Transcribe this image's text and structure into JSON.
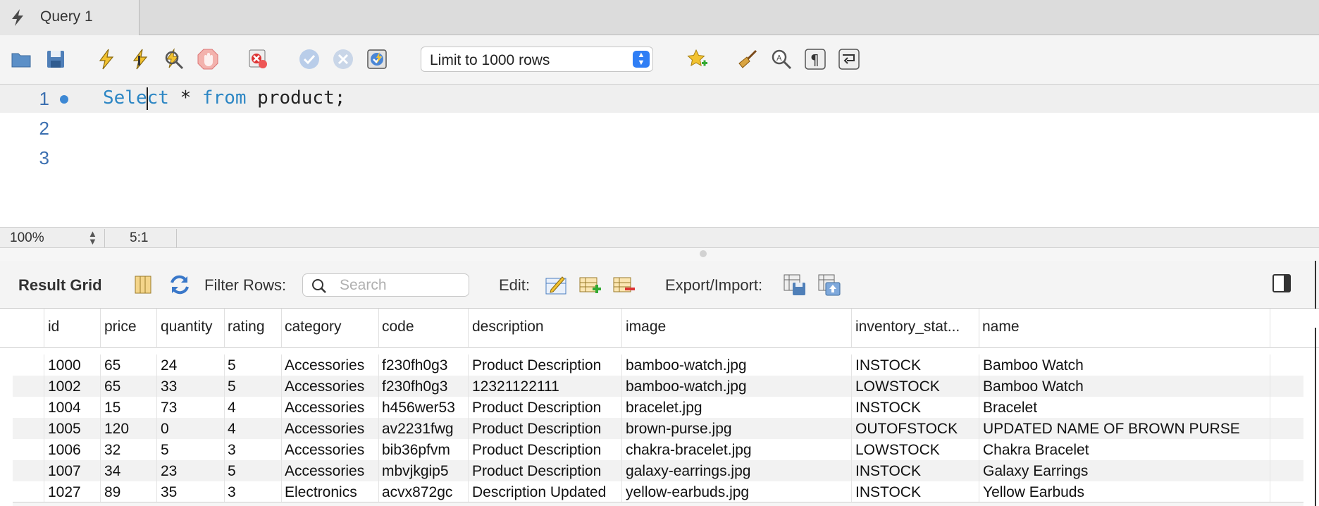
{
  "tab": {
    "title": "Query 1"
  },
  "toolbar": {
    "icons": [
      "open-folder-icon",
      "save-icon",
      "execute-icon",
      "execute-current-icon",
      "explain-icon",
      "stop-icon",
      "error-stop-icon",
      "commit-icon",
      "rollback-icon",
      "autocommit-icon",
      "bookmark-icon",
      "beautify-icon",
      "find-icon",
      "invisible-chars-icon",
      "wrap-icon"
    ],
    "limit_select": "Limit to 1000 rows"
  },
  "editor": {
    "lines": [
      {
        "number": "1",
        "keyword1": "Select",
        "middle": " * ",
        "keyword2": "from",
        "rest": " product;"
      },
      {
        "number": "2"
      },
      {
        "number": "3"
      }
    ],
    "keyword_color": "#2c86c4"
  },
  "statusbar": {
    "zoom": "100%",
    "cursor": "5:1"
  },
  "result": {
    "title": "Result Grid",
    "filter_label": "Filter Rows:",
    "search_placeholder": "Search",
    "edit_label": "Edit:",
    "export_label": "Export/Import:"
  },
  "grid": {
    "columns": [
      "id",
      "price",
      "quantity",
      "rating",
      "category",
      "code",
      "description",
      "image",
      "inventory_stat...",
      "name"
    ],
    "rows": [
      [
        "1000",
        "65",
        "24",
        "5",
        "Accessories",
        "f230fh0g3",
        "Product Description",
        "bamboo-watch.jpg",
        "INSTOCK",
        "Bamboo Watch"
      ],
      [
        "1002",
        "65",
        "33",
        "5",
        "Accessories",
        "f230fh0g3",
        "12321122111",
        "bamboo-watch.jpg",
        "LOWSTOCK",
        "Bamboo Watch"
      ],
      [
        "1004",
        "15",
        "73",
        "4",
        "Accessories",
        "h456wer53",
        "Product Description",
        "bracelet.jpg",
        "INSTOCK",
        "Bracelet"
      ],
      [
        "1005",
        "120",
        "0",
        "4",
        "Accessories",
        "av2231fwg",
        "Product Description",
        "brown-purse.jpg",
        "OUTOFSTOCK",
        "UPDATED NAME OF BROWN PURSE"
      ],
      [
        "1006",
        "32",
        "5",
        "3",
        "Accessories",
        "bib36pfvm",
        "Product Description",
        "chakra-bracelet.jpg",
        "LOWSTOCK",
        "Chakra Bracelet"
      ],
      [
        "1007",
        "34",
        "23",
        "5",
        "Accessories",
        "mbvjkgip5",
        "Product Description",
        "galaxy-earrings.jpg",
        "INSTOCK",
        "Galaxy Earrings"
      ],
      [
        "1027",
        "89",
        "35",
        "3",
        "Electronics",
        "acvx872gc",
        "Description Updated",
        "yellow-earbuds.jpg",
        "INSTOCK",
        "Yellow Earbuds"
      ]
    ]
  }
}
